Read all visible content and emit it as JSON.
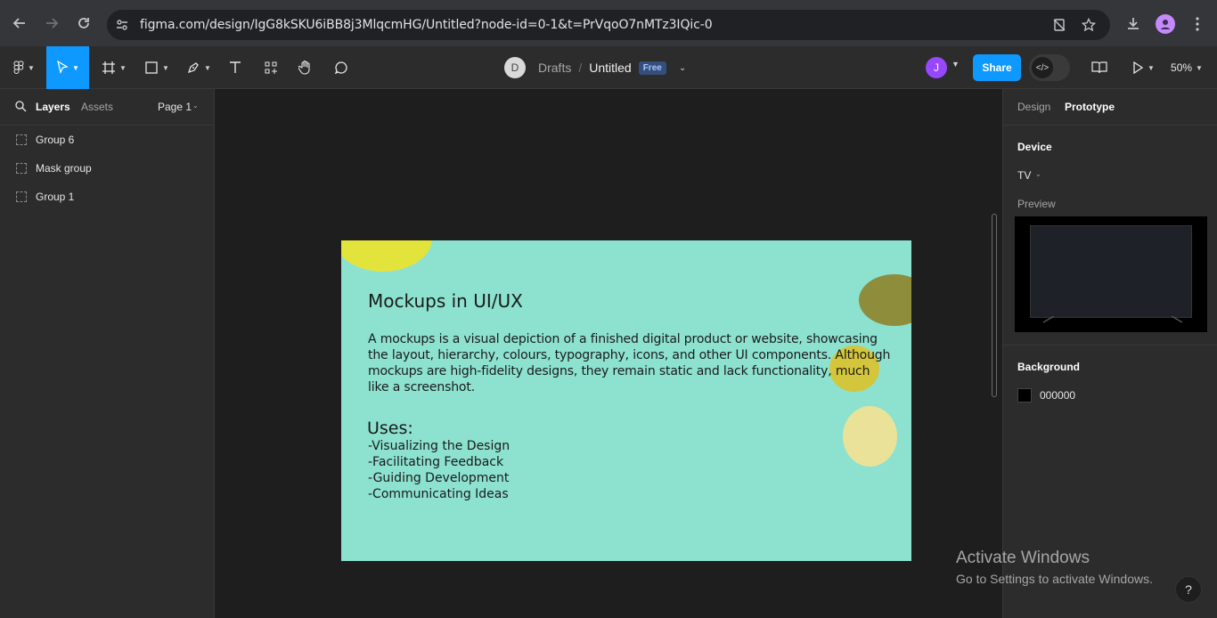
{
  "browser": {
    "url": "figma.com/design/IgG8kSKU6iBB8j3MlqcmHG/Untitled?node-id=0-1&t=PrVqoO7nMTz3IQic-0"
  },
  "toolbar": {
    "breadcrumb_team_initial": "D",
    "breadcrumb_folder": "Drafts",
    "breadcrumb_separator": "/",
    "file_name": "Untitled",
    "plan_badge": "Free",
    "user_initial": "J",
    "share_label": "Share",
    "zoom_level": "50%"
  },
  "left_panel": {
    "tab_layers": "Layers",
    "tab_assets": "Assets",
    "page_selector": "Page 1",
    "layers": [
      {
        "name": "Group 6"
      },
      {
        "name": "Mask group"
      },
      {
        "name": "Group 1"
      }
    ]
  },
  "canvas": {
    "frame": {
      "background": "#8ce2cf",
      "title": "Mockups in UI/UX",
      "paragraph_lines": [
        "A mockups is a visual depiction of a finished digital product or website, showcasing",
        "the layout, hierarchy, colours, typography, icons, and other UI components. Although",
        "mockups are high-fidelity designs, they remain static and lack functionality, much",
        "like a screenshot."
      ],
      "uses_heading": "Uses:",
      "uses_items": [
        "-Visualizing the Design",
        "-Facilitating Feedback",
        "-Guiding Development",
        "-Communicating Ideas"
      ]
    }
  },
  "right_panel": {
    "tab_design": "Design",
    "tab_prototype": "Prototype",
    "device_heading": "Device",
    "device_value": "TV",
    "preview_label": "Preview",
    "background_heading": "Background",
    "background_value": "000000",
    "background_color": "#000000"
  },
  "overlay": {
    "activate_title": "Activate Windows",
    "activate_sub": "Go to Settings to activate Windows.",
    "help_label": "?"
  },
  "colors": {
    "accent": "#0d99ff",
    "panel": "#2c2c2c",
    "canvas": "#1e1e1e"
  }
}
